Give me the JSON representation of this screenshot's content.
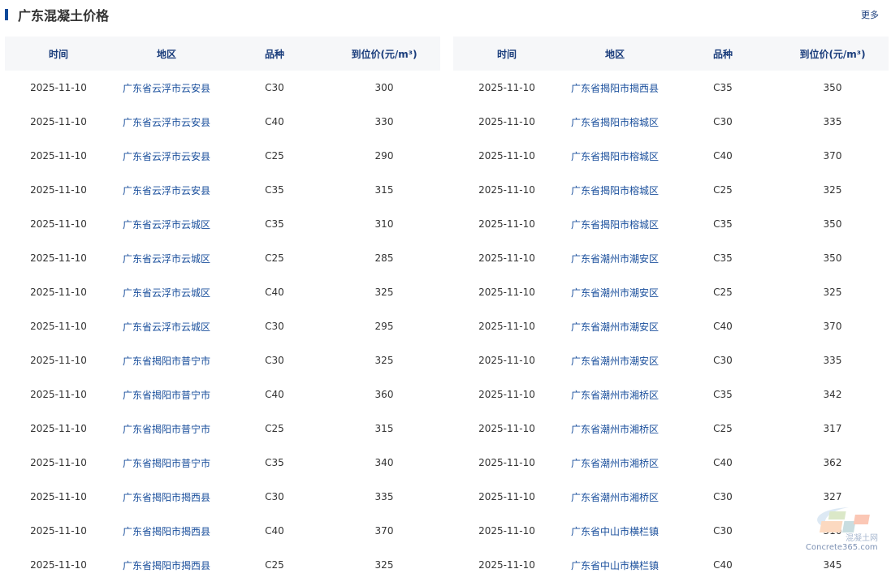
{
  "title": "广东混凝土价格",
  "more": "更多",
  "headers": [
    "时间",
    "地区",
    "品种",
    "到位价(元/m³)"
  ],
  "watermark": {
    "cn": "混凝土网",
    "en": "Concrete365.com"
  },
  "tables": [
    [
      [
        "2025-11-10",
        "广东省云浮市云安县",
        "C30",
        "300"
      ],
      [
        "2025-11-10",
        "广东省云浮市云安县",
        "C40",
        "330"
      ],
      [
        "2025-11-10",
        "广东省云浮市云安县",
        "C25",
        "290"
      ],
      [
        "2025-11-10",
        "广东省云浮市云安县",
        "C35",
        "315"
      ],
      [
        "2025-11-10",
        "广东省云浮市云城区",
        "C35",
        "310"
      ],
      [
        "2025-11-10",
        "广东省云浮市云城区",
        "C25",
        "285"
      ],
      [
        "2025-11-10",
        "广东省云浮市云城区",
        "C40",
        "325"
      ],
      [
        "2025-11-10",
        "广东省云浮市云城区",
        "C30",
        "295"
      ],
      [
        "2025-11-10",
        "广东省揭阳市普宁市",
        "C30",
        "325"
      ],
      [
        "2025-11-10",
        "广东省揭阳市普宁市",
        "C40",
        "360"
      ],
      [
        "2025-11-10",
        "广东省揭阳市普宁市",
        "C25",
        "315"
      ],
      [
        "2025-11-10",
        "广东省揭阳市普宁市",
        "C35",
        "340"
      ],
      [
        "2025-11-10",
        "广东省揭阳市揭西县",
        "C30",
        "335"
      ],
      [
        "2025-11-10",
        "广东省揭阳市揭西县",
        "C40",
        "370"
      ],
      [
        "2025-11-10",
        "广东省揭阳市揭西县",
        "C25",
        "325"
      ]
    ],
    [
      [
        "2025-11-10",
        "广东省揭阳市揭西县",
        "C35",
        "350"
      ],
      [
        "2025-11-10",
        "广东省揭阳市榕城区",
        "C30",
        "335"
      ],
      [
        "2025-11-10",
        "广东省揭阳市榕城区",
        "C40",
        "370"
      ],
      [
        "2025-11-10",
        "广东省揭阳市榕城区",
        "C25",
        "325"
      ],
      [
        "2025-11-10",
        "广东省揭阳市榕城区",
        "C35",
        "350"
      ],
      [
        "2025-11-10",
        "广东省潮州市潮安区",
        "C35",
        "350"
      ],
      [
        "2025-11-10",
        "广东省潮州市潮安区",
        "C25",
        "325"
      ],
      [
        "2025-11-10",
        "广东省潮州市潮安区",
        "C40",
        "370"
      ],
      [
        "2025-11-10",
        "广东省潮州市潮安区",
        "C30",
        "335"
      ],
      [
        "2025-11-10",
        "广东省潮州市湘桥区",
        "C35",
        "342"
      ],
      [
        "2025-11-10",
        "广东省潮州市湘桥区",
        "C25",
        "317"
      ],
      [
        "2025-11-10",
        "广东省潮州市湘桥区",
        "C40",
        "362"
      ],
      [
        "2025-11-10",
        "广东省潮州市湘桥区",
        "C30",
        "327"
      ],
      [
        "2025-11-10",
        "广东省中山市横栏镇",
        "C30",
        "310"
      ],
      [
        "2025-11-10",
        "广东省中山市横栏镇",
        "C40",
        "345"
      ]
    ]
  ]
}
